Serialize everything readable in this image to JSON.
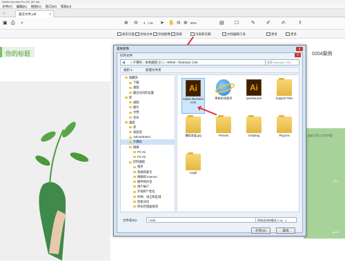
{
  "app": {
    "title": "Adobe Acrobat Pro DC (32-bit)"
  },
  "menus": [
    "文件(F)",
    "编辑(E)",
    "视图(V)",
    "窗口(W)",
    "帮助(H)"
  ],
  "tabs": [
    {
      "label": "逼没文件.pdf"
    }
  ],
  "toolbar": {
    "page_current": "4",
    "page_total": "/ 16",
    "zoom": "80%"
  },
  "subbar": [
    "裁剪页面",
    "添加文本",
    "添加图像",
    "链接",
    "页眉和页脚",
    "文档编辑工具",
    "更多",
    "更多"
  ],
  "doc": {
    "heading": "你的标题",
    "case_text": "0204案例",
    "right_text_1": "此处可写入文字内容",
    "right_text_2": "R-1",
    "right_text_3": "perth"
  },
  "dialog": {
    "outer_title": "置换图像",
    "inner_title": "打开文件",
    "address": "« 计算机 › 本地磁盘 (C:) › ARDM › Illustrator CS6",
    "search_placeholder": "搜索 Illustrator CS6",
    "cmd": {
      "organize": "组织 ▾",
      "newfolder": "新建文件夹"
    },
    "nav": [
      {
        "label": "收藏夹",
        "level": 1
      },
      {
        "label": "下载",
        "level": 2
      },
      {
        "label": "桌面",
        "level": 2
      },
      {
        "label": "最近访问的位置",
        "level": 2
      },
      {
        "label": "库",
        "level": 1
      },
      {
        "label": "视频",
        "level": 2
      },
      {
        "label": "图片",
        "level": 2
      },
      {
        "label": "文档",
        "level": 2
      },
      {
        "label": "音乐",
        "level": 2
      },
      {
        "label": "桌面",
        "level": 1
      },
      {
        "label": "库",
        "level": 2
      },
      {
        "label": "家庭组",
        "level": 2
      },
      {
        "label": "Administrator",
        "level": 2
      },
      {
        "label": "计算机",
        "level": 2
      },
      {
        "label": "网络",
        "level": 2
      },
      {
        "label": "PC-01",
        "level": 3
      },
      {
        "label": "PC-02",
        "level": 3
      },
      {
        "label": "控制面板",
        "level": 2
      },
      {
        "label": "程序",
        "level": 3
      },
      {
        "label": "系统和安全",
        "level": 3
      },
      {
        "label": "网络和 Internet",
        "level": 3
      },
      {
        "label": "硬件和声音",
        "level": 3
      },
      {
        "label": "用户帐户",
        "level": 3
      },
      {
        "label": "外观和个性化",
        "level": 3
      },
      {
        "label": "时钟、语言和区域",
        "level": 3
      },
      {
        "label": "轻松访问",
        "level": 3
      },
      {
        "label": "所有控制面板项",
        "level": 3
      }
    ],
    "files": [
      {
        "label": "Adobe Illustrator CS6",
        "icon": "ai-icon"
      },
      {
        "label": "更新检测程序",
        "icon": "ie-icon"
      },
      {
        "label": "Quicklaunch",
        "icon": "ai-icon"
      },
      {
        "label": "Support Files",
        "icon": "folder-icon"
      },
      {
        "label": "横版发展.jpg",
        "icon": "folder-icon"
      },
      {
        "label": "Presets",
        "icon": "folder-icon"
      },
      {
        "label": "Scripting",
        "icon": "folder-icon"
      },
      {
        "label": "Plug-ins",
        "icon": "folder-icon"
      },
      {
        "label": "Legal",
        "icon": "folder-icon"
      }
    ],
    "filename_label": "文件名(N):",
    "filename_value": "*.exe",
    "filetype": "所有支持的格式 (*.ai;...)",
    "open_label": "打开(O)",
    "cancel_label": "取消"
  },
  "colors": {
    "accent_green": "#7bbf6a",
    "light_green": "#a7d39a",
    "arrow_red": "#dd3333"
  }
}
